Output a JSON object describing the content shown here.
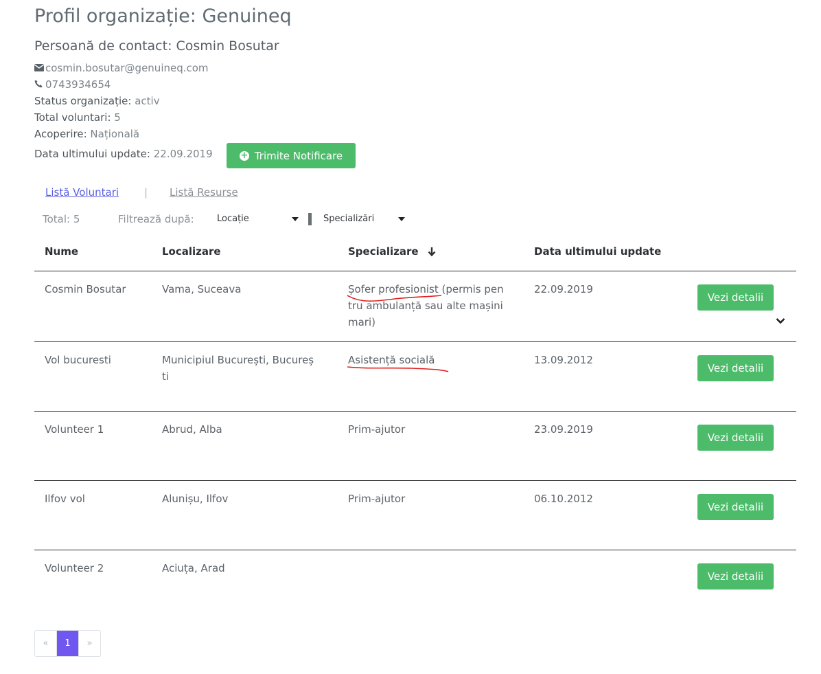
{
  "header": {
    "title": "Profil organizație: Genuineq",
    "contact_title": "Persoană de contact: Cosmin Bosutar"
  },
  "info": {
    "email": "cosmin.bosutar@genuineq.com",
    "phone": "0743934654",
    "status_label": "Status organizație:",
    "status_value": "activ",
    "total_label": "Total voluntari:",
    "total_value": "5",
    "coverage_label": "Acoperire:",
    "coverage_value": "Națională",
    "update_label": "Data ultimului update:",
    "update_value": "22.09.2019"
  },
  "notify_button": {
    "label": "Trimite Notificare",
    "icon": "plus-circle-icon"
  },
  "tabs": [
    {
      "label": "Listă Voluntari",
      "active": true
    },
    {
      "label": "Listă Resurse",
      "active": false
    }
  ],
  "tab_separator": "|",
  "filters": {
    "total_text": "Total: 5",
    "label": "Filtrează după:",
    "location": "Locație",
    "specialization": "Specializări"
  },
  "table": {
    "headers": [
      "Nume",
      "Localizare",
      "Specializare",
      "Data ultimului update"
    ],
    "sort_arrow": "🡣",
    "rows": [
      {
        "name": "Cosmin Bosutar",
        "location_lines": [
          "Vama, Suceava"
        ],
        "spec_lines": [
          "Șofer profesionist (permis pen",
          "tru ambulanță sau alte mașini",
          "mari)"
        ],
        "date": "22.09.2019",
        "button": "Vezi detalii"
      },
      {
        "name": "Vol bucuresti",
        "location_lines": [
          "Municipiul București, Bucureș",
          "ti"
        ],
        "spec_lines": [
          "Asistență socială"
        ],
        "date": "13.09.2012",
        "button": "Vezi detalii"
      },
      {
        "name": "Volunteer 1",
        "location_lines": [
          "Abrud, Alba"
        ],
        "spec_lines": [
          "Prim-ajutor"
        ],
        "date": "23.09.2019",
        "button": "Vezi detalii"
      },
      {
        "name": "Ilfov vol",
        "location_lines": [
          "Alunișu, Ilfov"
        ],
        "spec_lines": [
          "Prim-ajutor"
        ],
        "date": "06.10.2012",
        "button": "Vezi detalii"
      },
      {
        "name": "Volunteer 2",
        "location_lines": [
          "Aciuța, Arad"
        ],
        "spec_lines": [
          ""
        ],
        "date": "",
        "button": "Vezi detalii"
      }
    ]
  },
  "pagination": {
    "prev": "«",
    "current": "1",
    "next": "»"
  },
  "colors": {
    "accent_green": "#4cbc6a",
    "pager_active": "#6f57f0",
    "spellcheck_red": "#e02020"
  }
}
